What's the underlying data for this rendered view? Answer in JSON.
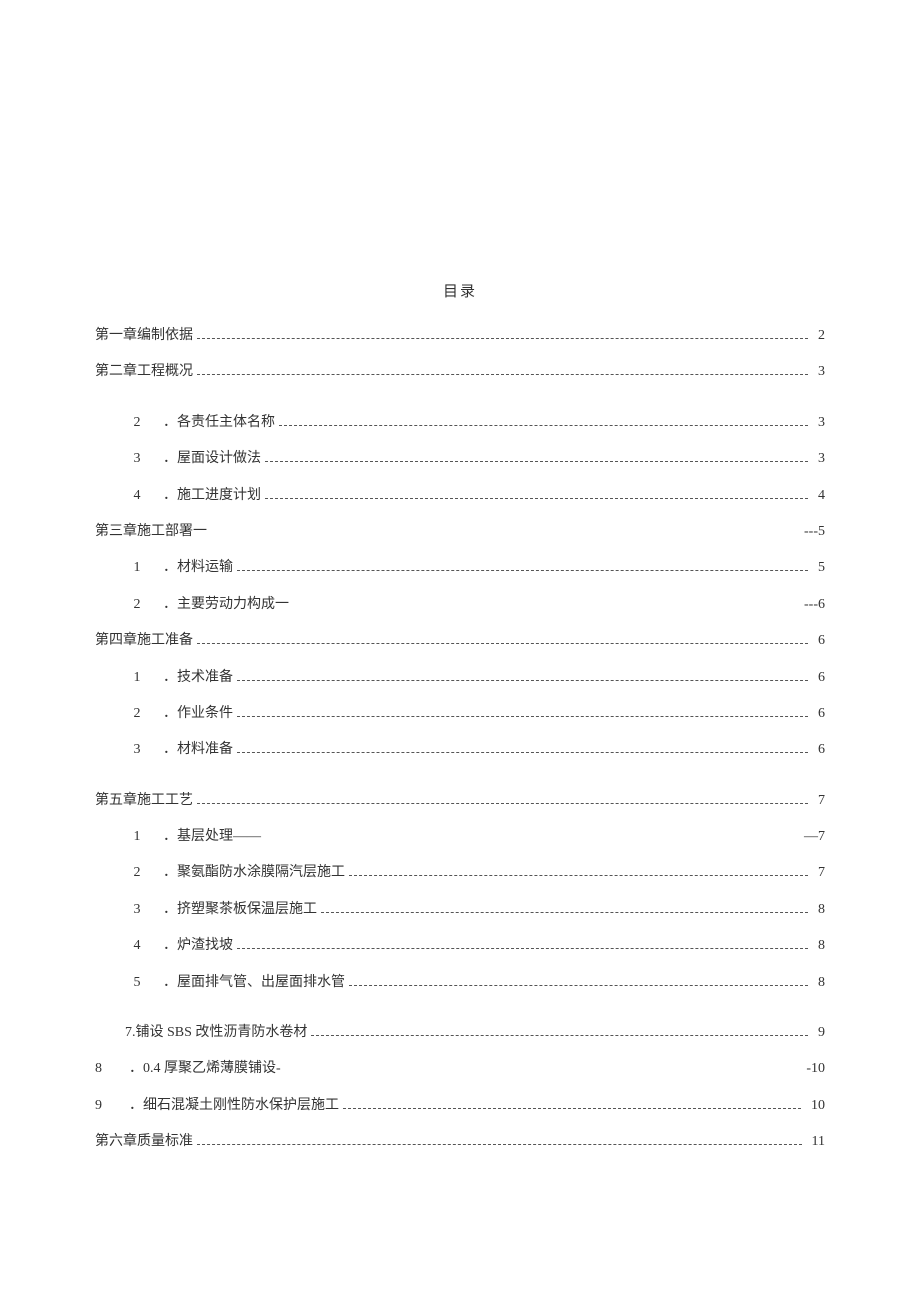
{
  "title": "目录",
  "entries": [
    {
      "indent": 0,
      "num": "",
      "text": "第一章编制依据",
      "leader": "dots",
      "page": "2"
    },
    {
      "indent": 0,
      "num": "",
      "text": "第二章工程概况",
      "leader": "dots",
      "page": "3"
    },
    {
      "gap": true
    },
    {
      "indent": 1,
      "num": "2",
      "text": "．各责任主体名称",
      "leader": "dots",
      "page": "3"
    },
    {
      "indent": 1,
      "num": "3",
      "text": "．屋面设计做法",
      "leader": "dots",
      "page": "3"
    },
    {
      "indent": 1,
      "num": "4",
      "text": "．施工进度计划",
      "leader": "dots",
      "page": "4"
    },
    {
      "indent": 0,
      "num": "",
      "text": "第三章施工部署一",
      "leader": "space",
      "page": "---5"
    },
    {
      "indent": 1,
      "num": "1",
      "text": "．材料运输",
      "leader": "dots",
      "page": "5"
    },
    {
      "indent": 1,
      "num": "2",
      "text": "．主要劳动力构成一",
      "leader": "space",
      "page": "---6"
    },
    {
      "indent": 0,
      "num": "",
      "text": "第四章施工准备",
      "leader": "dots",
      "page": "6"
    },
    {
      "indent": 1,
      "num": "1",
      "text": "．技术准备",
      "leader": "dots",
      "page": "6"
    },
    {
      "indent": 1,
      "num": "2",
      "text": "．作业条件",
      "leader": "dots",
      "page": "6"
    },
    {
      "indent": 1,
      "num": "3",
      "text": "．材料准备",
      "leader": "dots",
      "page": "6"
    },
    {
      "gap": true
    },
    {
      "indent": 0,
      "num": "",
      "text": "第五章施工工艺",
      "leader": "dots",
      "page": "7"
    },
    {
      "indent": 1,
      "num": "1",
      "text": "．基层处理——",
      "leader": "space",
      "page": "—7"
    },
    {
      "indent": 1,
      "num": "2",
      "text": "．聚氨酯防水涂膜隔汽层施工",
      "leader": "dots",
      "page": "7"
    },
    {
      "indent": 1,
      "num": "3",
      "text": "．挤塑聚茶板保温层施工",
      "leader": "dots",
      "page": "8"
    },
    {
      "indent": 1,
      "num": "4",
      "text": "．炉渣找坡",
      "leader": "dots",
      "page": "8"
    },
    {
      "indent": 1,
      "num": "5",
      "text": "．屋面排气管、出屋面排水管",
      "leader": "dots",
      "page": "8"
    },
    {
      "gap": true
    },
    {
      "indent": 1,
      "num": "",
      "text": "7.铺设 SBS 改性沥青防水卷材",
      "leader": "dots",
      "page": "9"
    },
    {
      "indent": 0,
      "num": "8",
      "numLeft": true,
      "text": "．0.4 厚聚乙烯薄膜铺设-",
      "leader": "space",
      "page": "-10"
    },
    {
      "indent": 0,
      "num": "9",
      "numLeft": true,
      "text": "．细石混凝土刚性防水保护层施工",
      "leader": "dots",
      "page": "10"
    },
    {
      "indent": 0,
      "num": "",
      "text": "第六章质量标准",
      "leader": "dots",
      "page": "11"
    }
  ]
}
